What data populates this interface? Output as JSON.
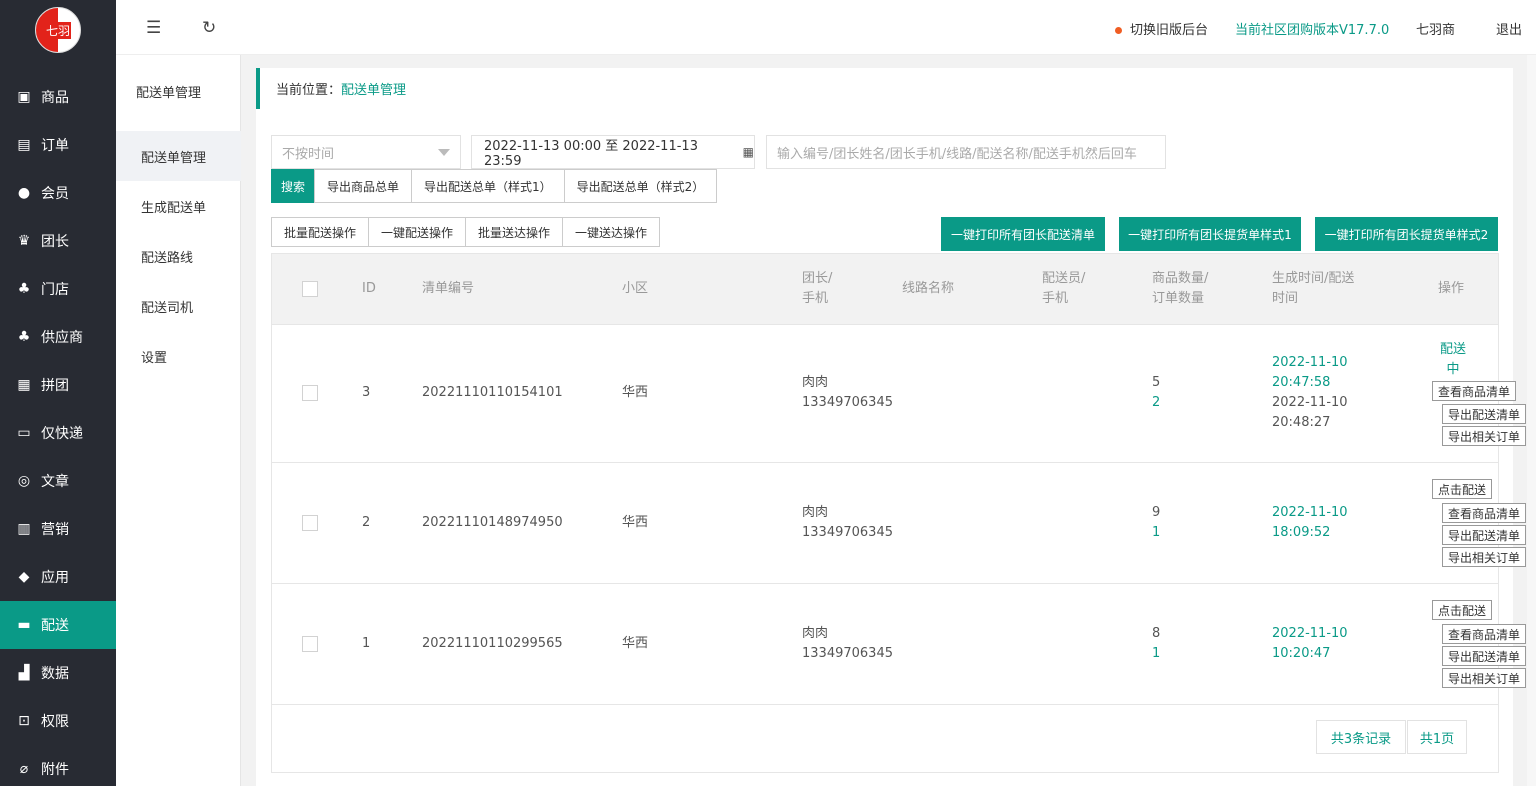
{
  "brand": {
    "logo_text": "七羽"
  },
  "sidebar": {
    "items": [
      {
        "label": "商品",
        "icon": "shop-icon"
      },
      {
        "label": "订单",
        "icon": "order-icon"
      },
      {
        "label": "会员",
        "icon": "members-icon"
      },
      {
        "label": "团长",
        "icon": "crown-icon"
      },
      {
        "label": "门店",
        "icon": "store-icon"
      },
      {
        "label": "供应商",
        "icon": "supplier-icon"
      },
      {
        "label": "拼团",
        "icon": "groupbuy-icon"
      },
      {
        "label": "仅快递",
        "icon": "truck-store-icon"
      },
      {
        "label": "文章",
        "icon": "compass-icon"
      },
      {
        "label": "营销",
        "icon": "gift-icon"
      },
      {
        "label": "应用",
        "icon": "cube-icon"
      },
      {
        "label": "配送",
        "icon": "delivery-truck-icon",
        "active": true
      },
      {
        "label": "数据",
        "icon": "chart-icon"
      },
      {
        "label": "权限",
        "icon": "lock-icon"
      },
      {
        "label": "附件",
        "icon": "attachment-icon"
      }
    ]
  },
  "subnav": {
    "title": "配送单管理",
    "items": [
      "配送单管理",
      "生成配送单",
      "配送路线",
      "配送司机",
      "设置"
    ]
  },
  "topbar": {
    "switch_old": "切换旧版后台",
    "version": "当前社区团购版本V17.7.0",
    "user": "七羽商",
    "logout": "退出"
  },
  "breadcrumb": {
    "prefix": "当前位置：",
    "current": "配送单管理"
  },
  "filters": {
    "time_select": "不按时间",
    "date_range": "2022-11-13 00:00 至 2022-11-13 23:59",
    "search_placeholder": "输入编号/团长姓名/团长手机/线路/配送名称/配送手机然后回车"
  },
  "toolbar1": [
    "搜索",
    "导出商品总单",
    "导出配送总单（样式1）",
    "导出配送总单（样式2）"
  ],
  "toolbar2": [
    "批量配送操作",
    "一键配送操作",
    "批量送达操作",
    "一键送达操作"
  ],
  "print_buttons": [
    "一键打印所有团长配送清单",
    "一键打印所有团长提货单样式1",
    "一键打印所有团长提货单样式2"
  ],
  "table": {
    "headers": {
      "id": "ID",
      "sn": "清单编号",
      "community": "小区",
      "leader1": "团长/",
      "leader2": "手机",
      "route": "线路名称",
      "driver1": "配送员/",
      "driver2": "手机",
      "qty1": "商品数量/",
      "qty2": "订单数量",
      "time1": "生成时间/配送",
      "time2": "时间",
      "action": "操作"
    },
    "rows": [
      {
        "id": "3",
        "sn": "20221110110154101",
        "community": "华西",
        "leader": "肉肉",
        "phone": "13349706345",
        "goods": "5",
        "orders": "2",
        "create_date": "2022-11-10",
        "create_time": "20:47:58",
        "deliver_date": "2022-11-10",
        "deliver_time": "20:48:27",
        "status1": "配送",
        "status2": "中",
        "actions": [
          "查看商品清单",
          "导出配送清单",
          "导出相关订单"
        ]
      },
      {
        "id": "2",
        "sn": "20221110148974950",
        "community": "华西",
        "leader": "肉肉",
        "phone": "13349706345",
        "goods": "9",
        "orders": "1",
        "create_date": "2022-11-10",
        "create_time": "18:09:52",
        "actions": [
          "点击配送",
          "查看商品清单",
          "导出配送清单",
          "导出相关订单"
        ]
      },
      {
        "id": "1",
        "sn": "20221110110299565",
        "community": "华西",
        "leader": "肉肉",
        "phone": "13349706345",
        "goods": "8",
        "orders": "1",
        "create_date": "2022-11-10",
        "create_time": "10:20:47",
        "actions": [
          "点击配送",
          "查看商品清单",
          "导出配送清单",
          "导出相关订单"
        ]
      }
    ]
  },
  "pager": {
    "total": "共3条记录",
    "pages": "共1页"
  }
}
